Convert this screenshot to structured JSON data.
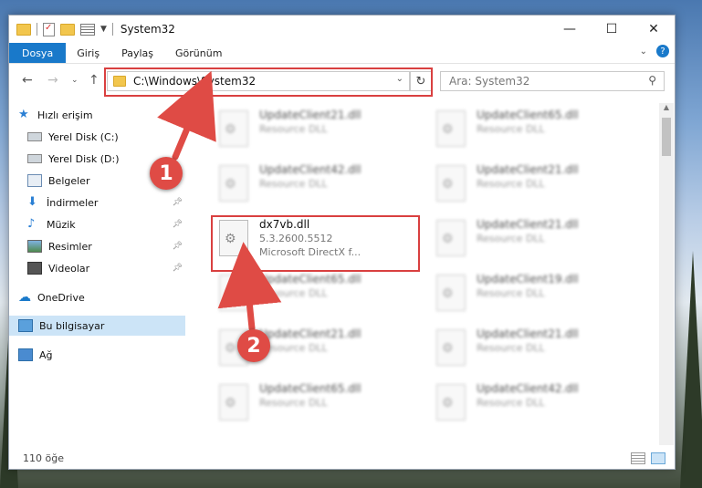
{
  "window": {
    "title": "System32",
    "controls": {
      "minimize": "—",
      "maximize": "☐",
      "close": "✕"
    }
  },
  "ribbon": {
    "tabs": [
      "Dosya",
      "Giriş",
      "Paylaş",
      "Görünüm"
    ],
    "help": "?"
  },
  "address": {
    "path": "C:\\Windows\\System32",
    "search_placeholder": "Ara: System32"
  },
  "sidebar": {
    "quick_access": "Hızlı erişim",
    "items": [
      {
        "label": "Yerel Disk (C:)",
        "icon": "drive-icon",
        "pinned": false
      },
      {
        "label": "Yerel Disk (D:)",
        "icon": "drive-icon",
        "pinned": false
      },
      {
        "label": "Belgeler",
        "icon": "documents-icon",
        "pinned": true
      },
      {
        "label": "İndirmeler",
        "icon": "downloads-icon",
        "pinned": true
      },
      {
        "label": "Müzik",
        "icon": "music-icon",
        "pinned": true
      },
      {
        "label": "Resimler",
        "icon": "pictures-icon",
        "pinned": true
      },
      {
        "label": "Videolar",
        "icon": "videos-icon",
        "pinned": true
      }
    ],
    "onedrive": "OneDrive",
    "this_pc": "Bu bilgisayar",
    "network": "Ağ"
  },
  "files": {
    "left": [
      {
        "name": "UpdateClient21.dll",
        "sub": "Resource DLL"
      },
      {
        "name": "UpdateClient42.dll",
        "sub": "Resource DLL"
      },
      {
        "name": "dx7vb.dll",
        "sub": "5.3.2600.5512",
        "sub2": "Microsoft DirectX f..."
      },
      {
        "name": "UpdateClient65.dll",
        "sub": "Resource DLL"
      },
      {
        "name": "UpdateClient21.dll",
        "sub": "Resource DLL"
      },
      {
        "name": "UpdateClient65.dll",
        "sub": "Resource DLL"
      }
    ],
    "right": [
      {
        "name": "UpdateClient65.dll",
        "sub": "Resource DLL"
      },
      {
        "name": "UpdateClient21.dll",
        "sub": "Resource DLL"
      },
      {
        "name": "UpdateClient21.dll",
        "sub": "Resource DLL"
      },
      {
        "name": "UpdateClient19.dll",
        "sub": "Resource DLL"
      },
      {
        "name": "UpdateClient21.dll",
        "sub": "Resource DLL"
      },
      {
        "name": "UpdateClient42.dll",
        "sub": "Resource DLL"
      }
    ]
  },
  "status": {
    "count": "110 öğe"
  },
  "callouts": [
    "1",
    "2"
  ],
  "colors": {
    "accent": "#1979ca",
    "highlight": "#d94040",
    "callout": "#df4b45"
  }
}
